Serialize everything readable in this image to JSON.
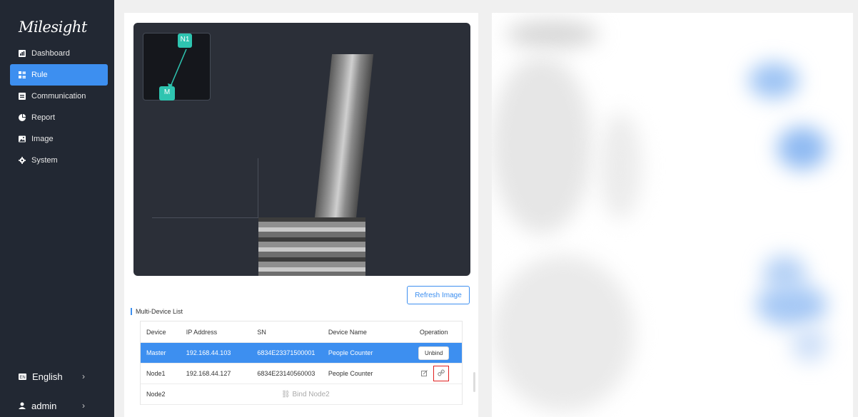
{
  "brand": {
    "logo_text": "Milesight"
  },
  "sidebar": {
    "items": [
      {
        "label": "Dashboard",
        "icon": "dashboard-icon",
        "active": false
      },
      {
        "label": "Rule",
        "icon": "rule-icon",
        "active": true
      },
      {
        "label": "Communication",
        "icon": "communication-icon",
        "active": false
      },
      {
        "label": "Report",
        "icon": "report-icon",
        "active": false
      },
      {
        "label": "Image",
        "icon": "image-icon",
        "active": false
      },
      {
        "label": "System",
        "icon": "gear-icon",
        "active": false
      }
    ],
    "language": "English",
    "user": "admin"
  },
  "canvas": {
    "minimap_nodes": [
      "N1",
      "M"
    ]
  },
  "actions": {
    "refresh_label": "Refresh Image"
  },
  "device_list": {
    "title": "Multi-Device List",
    "columns": [
      "Device",
      "IP Address",
      "SN",
      "Device Name",
      "Operation"
    ],
    "rows": [
      {
        "device": "Master",
        "ip": "192.168.44.103",
        "sn": "6834E23371500001",
        "name": "People Counter",
        "operation": "Unbind"
      },
      {
        "device": "Node1",
        "ip": "192.168.44.127",
        "sn": "6834E23140560003",
        "name": "People Counter",
        "operation": ""
      },
      {
        "device": "Node2",
        "ip": "",
        "sn": "",
        "name": "",
        "operation": "",
        "bind_label": "Bind Node2"
      }
    ]
  },
  "colors": {
    "accent": "#3d8ff0",
    "sidebar": "#222833",
    "node": "#2ec4b0",
    "highlight": "#e02020"
  }
}
